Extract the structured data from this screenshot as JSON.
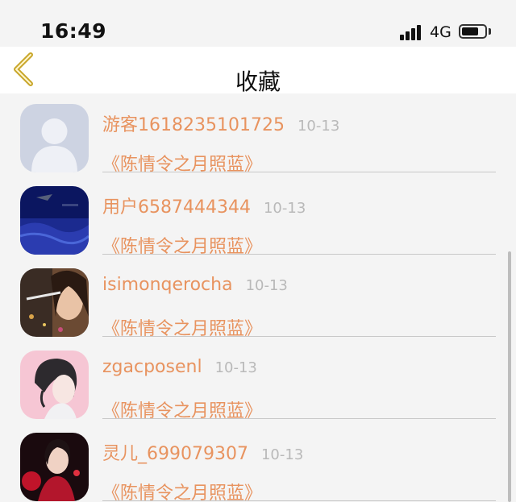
{
  "status_bar": {
    "time": "16:49",
    "network": "4G",
    "signal_bars": 4,
    "battery_level": 0.75
  },
  "nav": {
    "back_icon": "chevron-left-icon",
    "title": "收藏"
  },
  "colors": {
    "accent": "#e8935f",
    "date": "#b9b9b9",
    "back_chevron": "#c8a62a"
  },
  "entries": [
    {
      "username": "游客1618235101725",
      "date": "10-13",
      "book": "《陈情令之月照蓝》",
      "avatar": "default-user-avatar"
    },
    {
      "username": "用户6587444344",
      "date": "10-13",
      "book": "《陈情令之月照蓝》",
      "avatar": "blue-night-avatar"
    },
    {
      "username": "isimonqerocha",
      "date": "10-13",
      "book": "《陈情令之月照蓝》",
      "avatar": "portrait-girl-avatar"
    },
    {
      "username": "zgacposenl",
      "date": "10-13",
      "book": "《陈情令之月照蓝》",
      "avatar": "anime-girl-avatar"
    },
    {
      "username": "灵儿_699079307",
      "date": "10-13",
      "book": "《陈情令之月照蓝》",
      "avatar": "red-dress-girl-avatar"
    }
  ]
}
